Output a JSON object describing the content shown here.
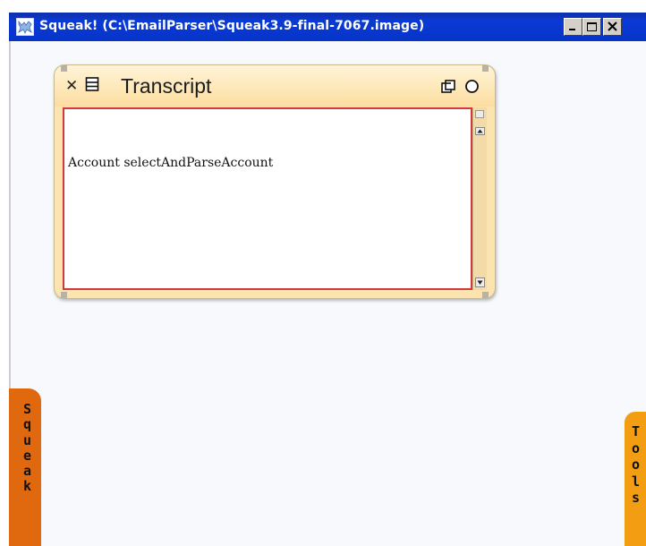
{
  "window": {
    "title": "Squeak! (C:\\EmailParser\\Squeak3.9-final-7067.image)",
    "controls": [
      "minimize",
      "maximize",
      "close"
    ]
  },
  "transcript": {
    "title": "Transcript",
    "content": "Account selectAndParseAccount",
    "close_icon": "close-icon",
    "menu_icon": "window-menu-icon",
    "collapse_icon": "collapse-icon",
    "expand_icon": "expand-icon"
  },
  "flaps": {
    "left": {
      "letters": [
        "S",
        "q",
        "u",
        "e",
        "a",
        "k"
      ],
      "color": "#e0680f"
    },
    "right": {
      "letters": [
        "T",
        "o",
        "o",
        "l",
        "s"
      ],
      "color": "#f39d12"
    }
  },
  "colors": {
    "titlebar": "#0634c8",
    "desktop": "#f7f9fd",
    "window_chrome": "#fce4b0",
    "text_border": "#d3383d"
  }
}
